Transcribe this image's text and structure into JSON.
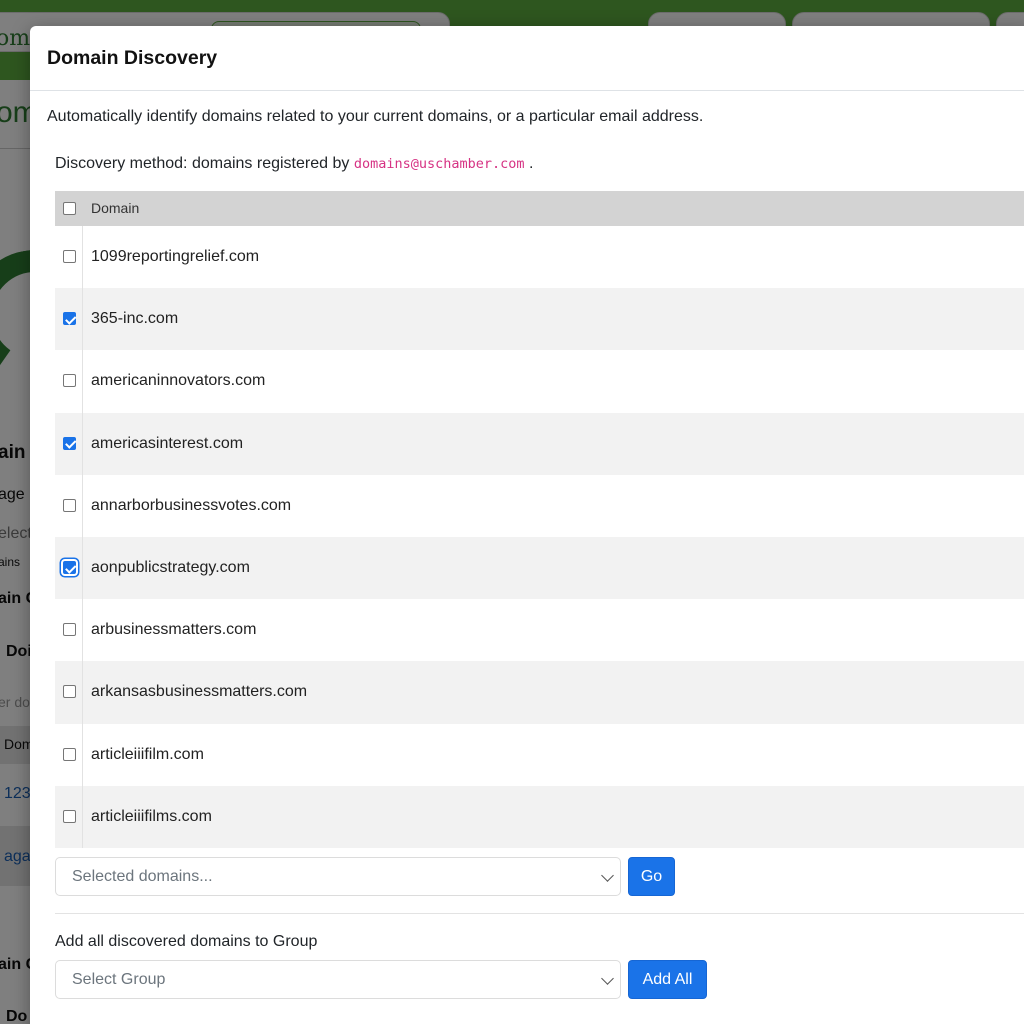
{
  "background": {
    "logo_fragment": "om",
    "big_fragment": "om",
    "fragments": [
      "ain",
      "age I",
      "elect",
      "ains",
      "ain G",
      "Doi",
      "er do",
      "Dom",
      "123",
      "aga",
      "ain G",
      "Do"
    ]
  },
  "modal": {
    "title": "Domain Discovery",
    "intro": "Automatically identify domains related to your current domains, or a particular email address.",
    "method_prefix": "Discovery method: domains registered by",
    "method_email": "domains@uschamber.com",
    "method_suffix": ".",
    "table": {
      "header": "Domain",
      "rows": [
        {
          "domain": "1099reportingrelief.com",
          "checked": false
        },
        {
          "domain": "365-inc.com",
          "checked": true
        },
        {
          "domain": "americaninnovators.com",
          "checked": false
        },
        {
          "domain": "americasinterest.com",
          "checked": true
        },
        {
          "domain": "annarborbusinessvotes.com",
          "checked": false
        },
        {
          "domain": "aonpublicstrategy.com",
          "checked": true,
          "focused": true
        },
        {
          "domain": "arbusinessmatters.com",
          "checked": false
        },
        {
          "domain": "arkansasbusinessmatters.com",
          "checked": false
        },
        {
          "domain": "articleiiifilm.com",
          "checked": false
        },
        {
          "domain": "articleiiifilms.com",
          "checked": false
        }
      ]
    },
    "selected_action": {
      "placeholder": "Selected domains...",
      "go_label": "Go"
    },
    "group": {
      "label": "Add all discovered domains to Group",
      "placeholder": "Select Group",
      "add_all_label": "Add All"
    }
  }
}
